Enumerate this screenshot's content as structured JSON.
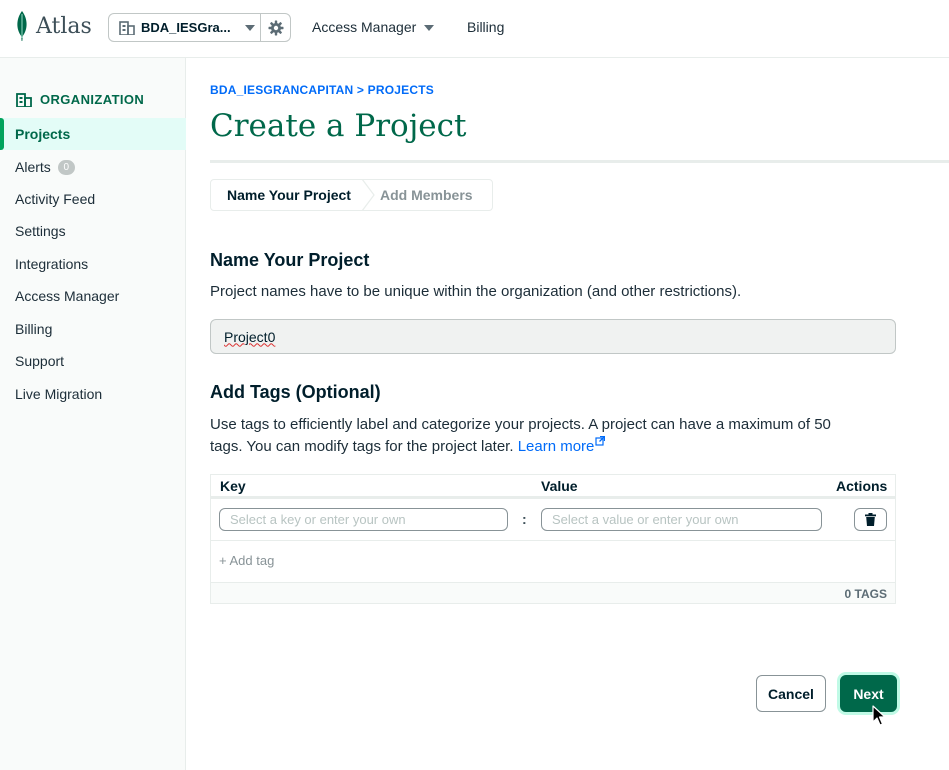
{
  "topbar": {
    "logo_text": "Atlas",
    "org_name": "BDA_IESGra...",
    "nav_access_manager": "Access Manager",
    "nav_billing": "Billing"
  },
  "sidebar": {
    "heading": "ORGANIZATION",
    "items": [
      {
        "label": "Projects",
        "active": true
      },
      {
        "label": "Alerts",
        "badge": "0"
      },
      {
        "label": "Activity Feed"
      },
      {
        "label": "Settings"
      },
      {
        "label": "Integrations"
      },
      {
        "label": "Access Manager"
      },
      {
        "label": "Billing"
      },
      {
        "label": "Support"
      },
      {
        "label": "Live Migration"
      }
    ]
  },
  "main": {
    "breadcrumb": "BDA_IESGRANCAPITAN > PROJECTS",
    "title": "Create a Project",
    "wizard": {
      "step1": "Name Your Project",
      "step2": "Add Members"
    },
    "name_section": {
      "heading": "Name Your Project",
      "description": "Project names have to be unique within the organization (and other restrictions).",
      "input_value": "Project0"
    },
    "tags_section": {
      "heading": "Add Tags (Optional)",
      "description_line1": "Use tags to efficiently label and categorize your projects. A project can have a maximum of 50",
      "description_line2": "tags. You can modify tags for the project later.",
      "learn_more": "Learn more",
      "col_key": "Key",
      "col_value": "Value",
      "col_actions": "Actions",
      "key_placeholder": "Select a key or enter your own",
      "separator": ":",
      "value_placeholder": "Select a value or enter your own",
      "add_tag": "+ Add tag",
      "tag_count": "0 TAGS"
    },
    "buttons": {
      "cancel": "Cancel",
      "next": "Next"
    }
  },
  "colors": {
    "brand_green": "#00684a",
    "accent_green": "#00a35c",
    "link_blue": "#016bf8"
  }
}
